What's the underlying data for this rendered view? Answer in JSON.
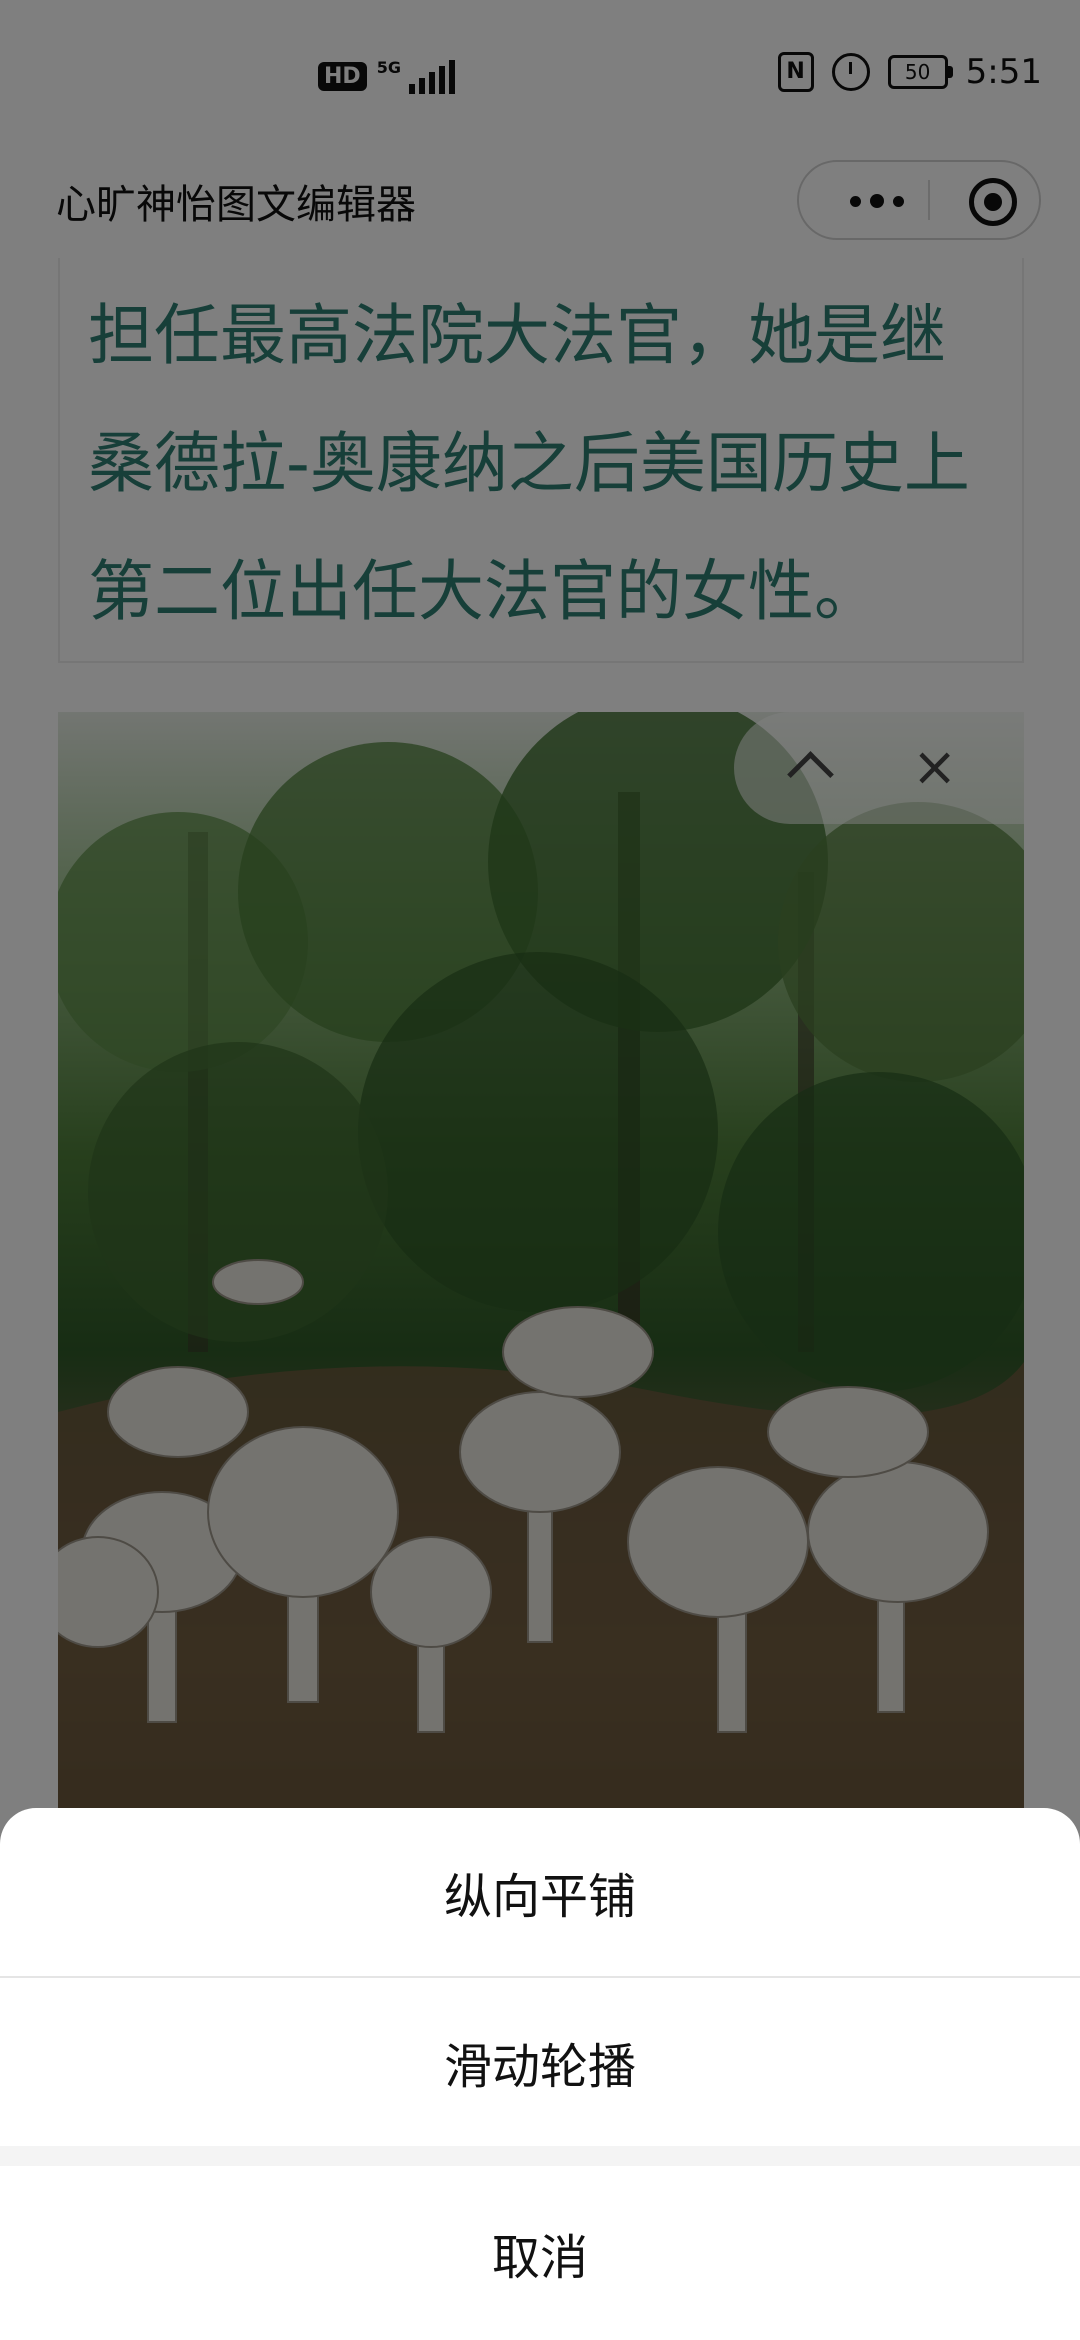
{
  "status_bar": {
    "hd": "HD",
    "network": "5G",
    "battery": "50",
    "time": "5:51"
  },
  "nav": {
    "title": "心旷神怡图文编辑器"
  },
  "article": {
    "lines": [
      "担任最高法院大法官，她是继",
      "桑德拉-奥康纳之后美国历史上",
      "第二位出任大法官的女性。"
    ],
    "text_color": "#2f7f73"
  },
  "image_toolbar": {
    "up_icon": "chevron-up-icon",
    "close_icon": "close-icon"
  },
  "action_sheet": {
    "option1": "纵向平铺",
    "option2": "滑动轮播",
    "cancel": "取消"
  }
}
